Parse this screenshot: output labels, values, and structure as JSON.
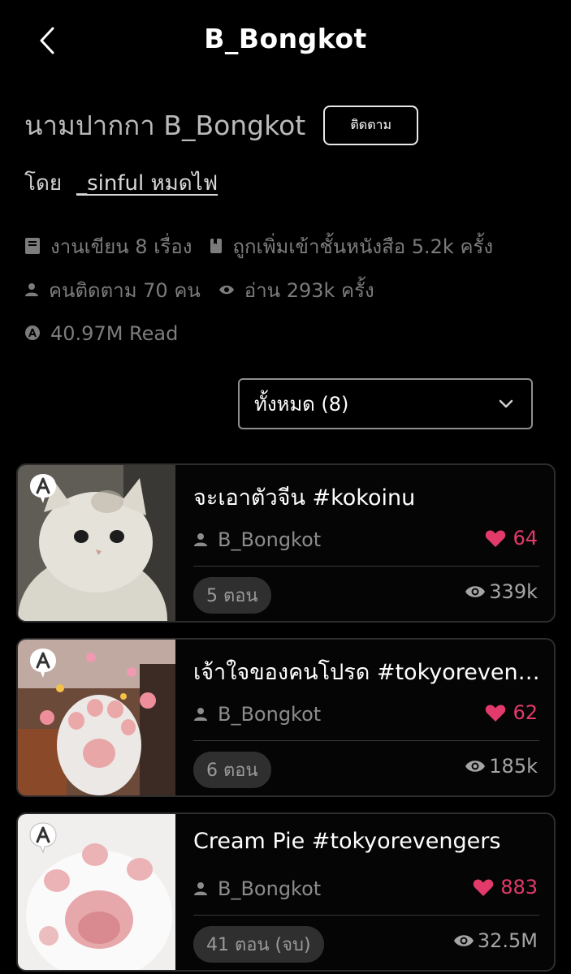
{
  "header": {
    "title": "B_Bongkot"
  },
  "profile": {
    "pen_name": "นามปากกา B_Bongkot",
    "follow_label": "ติดตาม",
    "by_label": "โดย",
    "by_user": "_sinful หมดไฟ"
  },
  "stats": {
    "works": "งานเขียน 8 เรื่อง",
    "shelf": "ถูกเพิ่มเข้าชั้นหนังสือ 5.2k ครั้ง",
    "followers": "คนติดตาม 70 คน",
    "reads": "อ่าน 293k ครั้ง",
    "total_read": "40.97M Read"
  },
  "filter": {
    "selected": "ทั้งหมด (8)"
  },
  "stories": [
    {
      "title": "จะเอาตัวจีน #kokoinu",
      "author": "B_Bongkot",
      "likes": "64",
      "episodes": "5 ตอน",
      "views": "339k"
    },
    {
      "title": "เจ้าใจของคนโปรด #tokyorevengers",
      "author": "B_Bongkot",
      "likes": "62",
      "episodes": "6 ตอน",
      "views": "185k"
    },
    {
      "title": "Cream Pie #tokyorevengers",
      "author": "B_Bongkot",
      "likes": "883",
      "episodes": "41 ตอน (จบ)",
      "views": "32.5M"
    }
  ],
  "colors": {
    "background": "#000000",
    "like": "#e23a6a",
    "muted": "#7c7c7c"
  }
}
